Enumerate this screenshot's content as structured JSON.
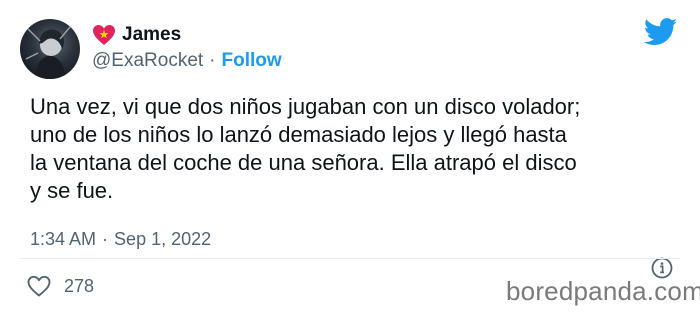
{
  "author": {
    "display_name": "James",
    "handle": "@ExaRocket",
    "separator": "·",
    "follow_label": "Follow"
  },
  "tweet": {
    "lines": [
      "Una vez, vi que dos niños jugaban con un disco volador;",
      "uno de los niños lo lanzó demasiado lejos y llegó hasta",
      "la ventana del coche de una señora. Ella atrapó el disco",
      "y se fue."
    ]
  },
  "meta": {
    "time": "1:34 AM",
    "separator": "·",
    "date": "Sep 1, 2022"
  },
  "engagement": {
    "likes": "278"
  },
  "watermark": "boredpanda.com",
  "colors": {
    "accent": "#1d9bf0",
    "muted_text": "#536471",
    "heart_badge": "#e0245e"
  },
  "icons": {
    "badge": "heart-icon",
    "brand": "twitter-bird-icon",
    "info": "info-icon",
    "like": "heart-outline-icon"
  }
}
